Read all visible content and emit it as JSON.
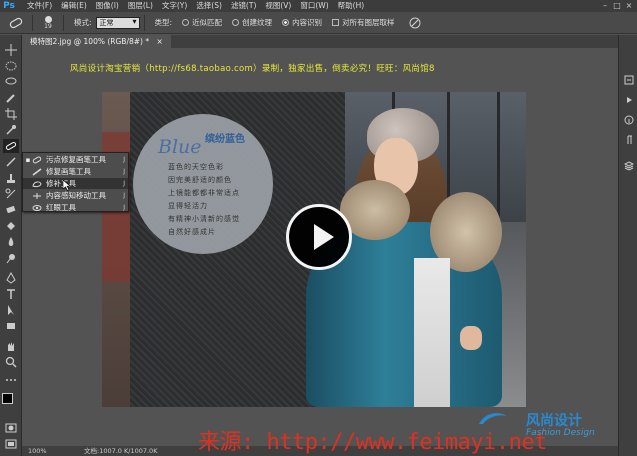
{
  "app": {
    "logo": "Ps",
    "menu": [
      "文件(F)",
      "编辑(E)",
      "图像(I)",
      "图层(L)",
      "文字(Y)",
      "选择(S)",
      "滤镜(T)",
      "视图(V)",
      "窗口(W)",
      "帮助(H)"
    ],
    "window_controls": [
      "–",
      "□",
      "×"
    ]
  },
  "options_bar": {
    "brush_size": "19",
    "mode_label": "模式:",
    "mode_value": "正常",
    "type_label": "类型:",
    "type_options": [
      "近似匹配",
      "创建纹理",
      "内容识别"
    ],
    "type_selected": "内容识别",
    "sample_all_layers": "对所有图层取样"
  },
  "document": {
    "tab_title": "模特图2.jpg @ 100% (RGB/8#) *",
    "tab_close": "×"
  },
  "canvas": {
    "top_watermark": "风尚设计淘宝营销（http://fs68.taobao.com）录制，独家出售，倒卖必究！旺旺：风尚馆8",
    "circle_script": "Blue",
    "circle_title": "缤纷蓝色",
    "circle_lines": [
      "蓝色的天空色彩",
      "因完美舒适的颜色",
      "上镜能都都非常适点",
      "显得轻活力",
      "有精神小清新的感觉",
      "自然好感成片"
    ]
  },
  "flyout": {
    "items": [
      {
        "label": "污点修复画笔工具",
        "shortcut": "J",
        "current": true
      },
      {
        "label": "修复画笔工具",
        "shortcut": "J",
        "current": false
      },
      {
        "label": "修补工具",
        "shortcut": "J",
        "current": false
      },
      {
        "label": "内容感知移动工具",
        "shortcut": "J",
        "current": false
      },
      {
        "label": "红眼工具",
        "shortcut": "J",
        "current": false
      }
    ]
  },
  "status": {
    "zoom": "100%",
    "doc_size": "文档:1007.0 K/1007.0K"
  },
  "watermark": {
    "source": "来源: http://www.feimayi.net",
    "brand": "风尚设计",
    "brand_en": "Fashion Design"
  },
  "colors": {
    "accent": "#31a8ff",
    "watermark_yellow": "#e8e83a",
    "watermark_red": "#e03020",
    "brand_blue": "#2a8ad0"
  }
}
